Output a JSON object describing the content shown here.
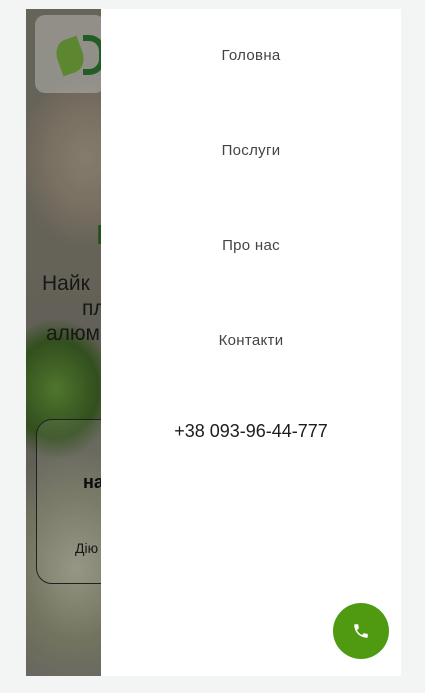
{
  "background": {
    "cut_word": "E",
    "heading_fragments": [
      "Найк",
      "пл",
      "алюм"
    ],
    "card_title_fragment": "на",
    "card_sub_fragment": "Дію"
  },
  "menu": {
    "items": [
      {
        "label": "Головна"
      },
      {
        "label": "Послуги"
      },
      {
        "label": "Про нас"
      },
      {
        "label": "Контакти"
      }
    ],
    "phone": "+38 093-96-44-777"
  },
  "call_button": {
    "icon": "phone-icon",
    "color": "#4f9a10"
  },
  "colors": {
    "accent": "#4f9a10",
    "panel": "#ffffff",
    "text": "#444444"
  }
}
